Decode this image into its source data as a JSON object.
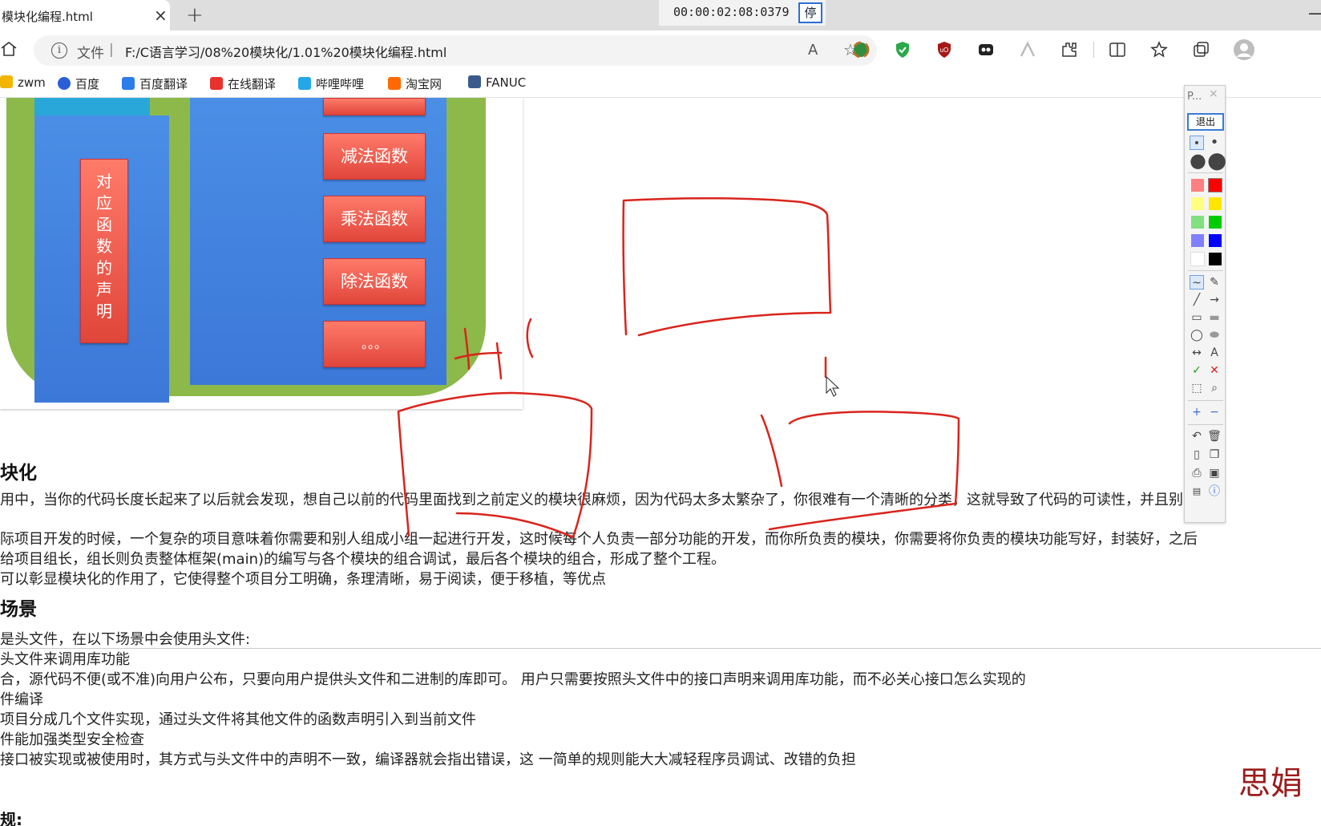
{
  "browser": {
    "tab_title": "模块化编程.html",
    "tab_close": "×",
    "new_tab": "+",
    "timer": "00:00:02:08:0379",
    "timer_button": "停",
    "minimize": "—",
    "file_label": "文件",
    "address_separator": "|",
    "url": "F:/C语言学习/08%20模块化/1.01%20模块化编程.html",
    "read_aloud": "A",
    "favorites_add": "☆"
  },
  "bookmarks": [
    {
      "label": "zwm",
      "color": "#f2b600"
    },
    {
      "label": "百度",
      "color": "#2b5fd9"
    },
    {
      "label": "百度翻译",
      "color": "#2b7de9"
    },
    {
      "label": "在线翻译",
      "color": "#e8322e"
    },
    {
      "label": "哔哩哔哩",
      "color": "#23a7e8"
    },
    {
      "label": "淘宝网",
      "color": "#ff6a00"
    },
    {
      "label": "FANUC",
      "color": "#3b5a8c"
    }
  ],
  "diagram": {
    "buttons": [
      "减法函数",
      "乘法函数",
      "除法函数",
      "。。。"
    ],
    "vertical_label": [
      "对",
      "应",
      "函",
      "数",
      "的",
      "声",
      "明"
    ]
  },
  "article": {
    "heading1": "块化",
    "para1": "用中，当你的代码长度长起来了以后就会发现，想自己以前的代码里面找到之前定义的模块很麻烦，因为代码太多太繁杂了，你很难有一个清晰的分类，这就导致了代码的可读性，并且别人",
    "para2": "际项目开发的时候，一个复杂的项目意味着你需要和别人组成小组一起进行开发，这时候每个人负责一部分功能的开发，而你所负责的模块，你需要将你负责的模块功能写好，封装好，之后",
    "para3": "给项目组长，组长则负责整体框架(main)的编写与各个模块的组合调试，最后各个模块的组合，形成了整个工程。",
    "para4": "可以彰显模块化的作用了，它使得整个项目分工明确，条理清晰，易于阅读，便于移植，等优点",
    "heading2": "场景",
    "lines": [
      "是头文件，在以下场景中会使用头文件:",
      "头文件来调用库功能",
      "合，源代码不便(或不准)向用户公布，只要向用户提供头文件和二进制的库即可。 用户只需要按照头文件中的接口声明来调用库功能，而不必关心接口怎么实现的",
      "件编译",
      "项目分成几个文件实现，通过头文件将其他文件的函数声明引入到当前文件",
      "件能加强类型安全检查",
      "接口被实现或被使用时，其方式与头文件中的声明不一致，编译器就会指出错误，这 一简单的规则能大大减轻程序员调试、改错的负担"
    ],
    "heading3": "规:"
  },
  "watermark": "思娟",
  "pen_panel": {
    "title": "P...",
    "close": "×",
    "exit": "退出",
    "colors": [
      "#ff8080",
      "#ff0000",
      "#ffff80",
      "#ffe600",
      "#80e080",
      "#00cc00",
      "#8080ff",
      "#0000ff",
      "#ffffff",
      "#000000"
    ],
    "ink_color": "#d9241c"
  }
}
